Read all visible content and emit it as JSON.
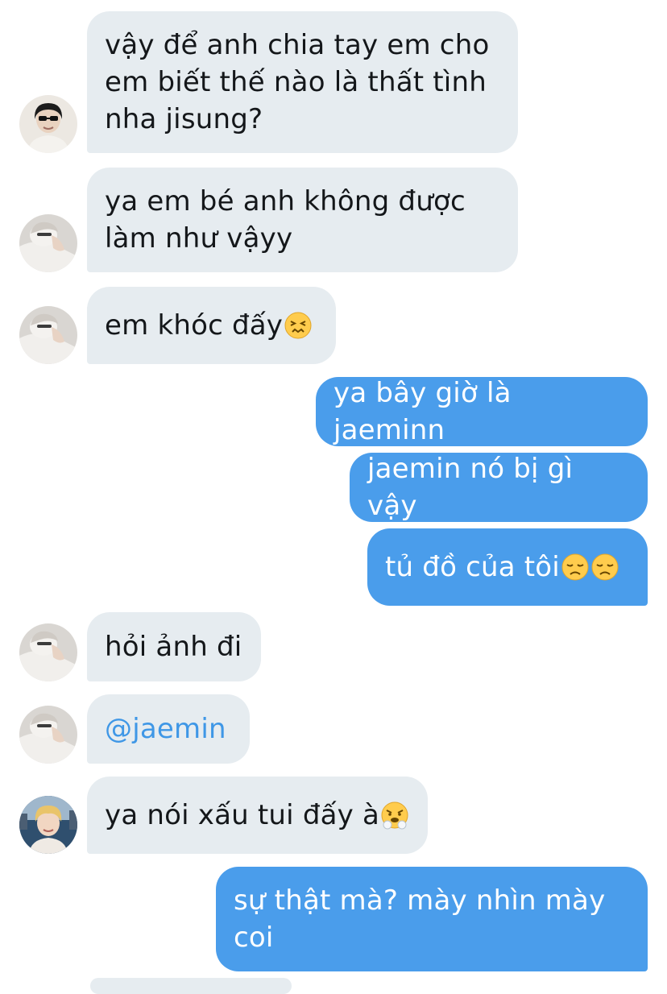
{
  "conversation": {
    "messages": [
      {
        "direction": "in",
        "avatar": "avatar-black-hood-icon",
        "text": "vậy để anh chia tay em cho\nem biết thế nào là thất tình\nnha jisung?"
      },
      {
        "direction": "in",
        "avatar": "avatar-praying-boy-icon",
        "text": "ya em bé anh không được\nlàm như vậyy"
      },
      {
        "direction": "in",
        "avatar": "avatar-praying-boy-icon",
        "text": "em khóc đấy",
        "emoji": [
          "confounded-face-icon"
        ]
      },
      {
        "direction": "out",
        "text": "ya bây giờ là jaeminn"
      },
      {
        "direction": "out",
        "text": "jaemin nó bị gì vậy"
      },
      {
        "direction": "out",
        "text": "tủ đồ của tôi",
        "emoji": [
          "disappointed-face-icon",
          "disappointed-face-icon"
        ]
      },
      {
        "direction": "in",
        "avatar": "avatar-praying-boy-icon",
        "text": "hỏi ảnh đi"
      },
      {
        "direction": "in",
        "avatar": "avatar-praying-boy-icon",
        "text": "@jaemin",
        "mention": true
      },
      {
        "direction": "in",
        "avatar": "avatar-blond-boy-icon",
        "text": "ya nói xấu tui đấy à",
        "emoji": [
          "triumph-face-icon"
        ]
      },
      {
        "direction": "out",
        "text": "sự thật mà? mày nhìn mày\ncoi"
      }
    ]
  },
  "colors": {
    "incoming_bubble": "#e6ecf0",
    "outgoing_bubble": "#4a9deb",
    "incoming_text": "#14171a",
    "outgoing_text": "#ffffff",
    "mention": "#3f97e6"
  }
}
